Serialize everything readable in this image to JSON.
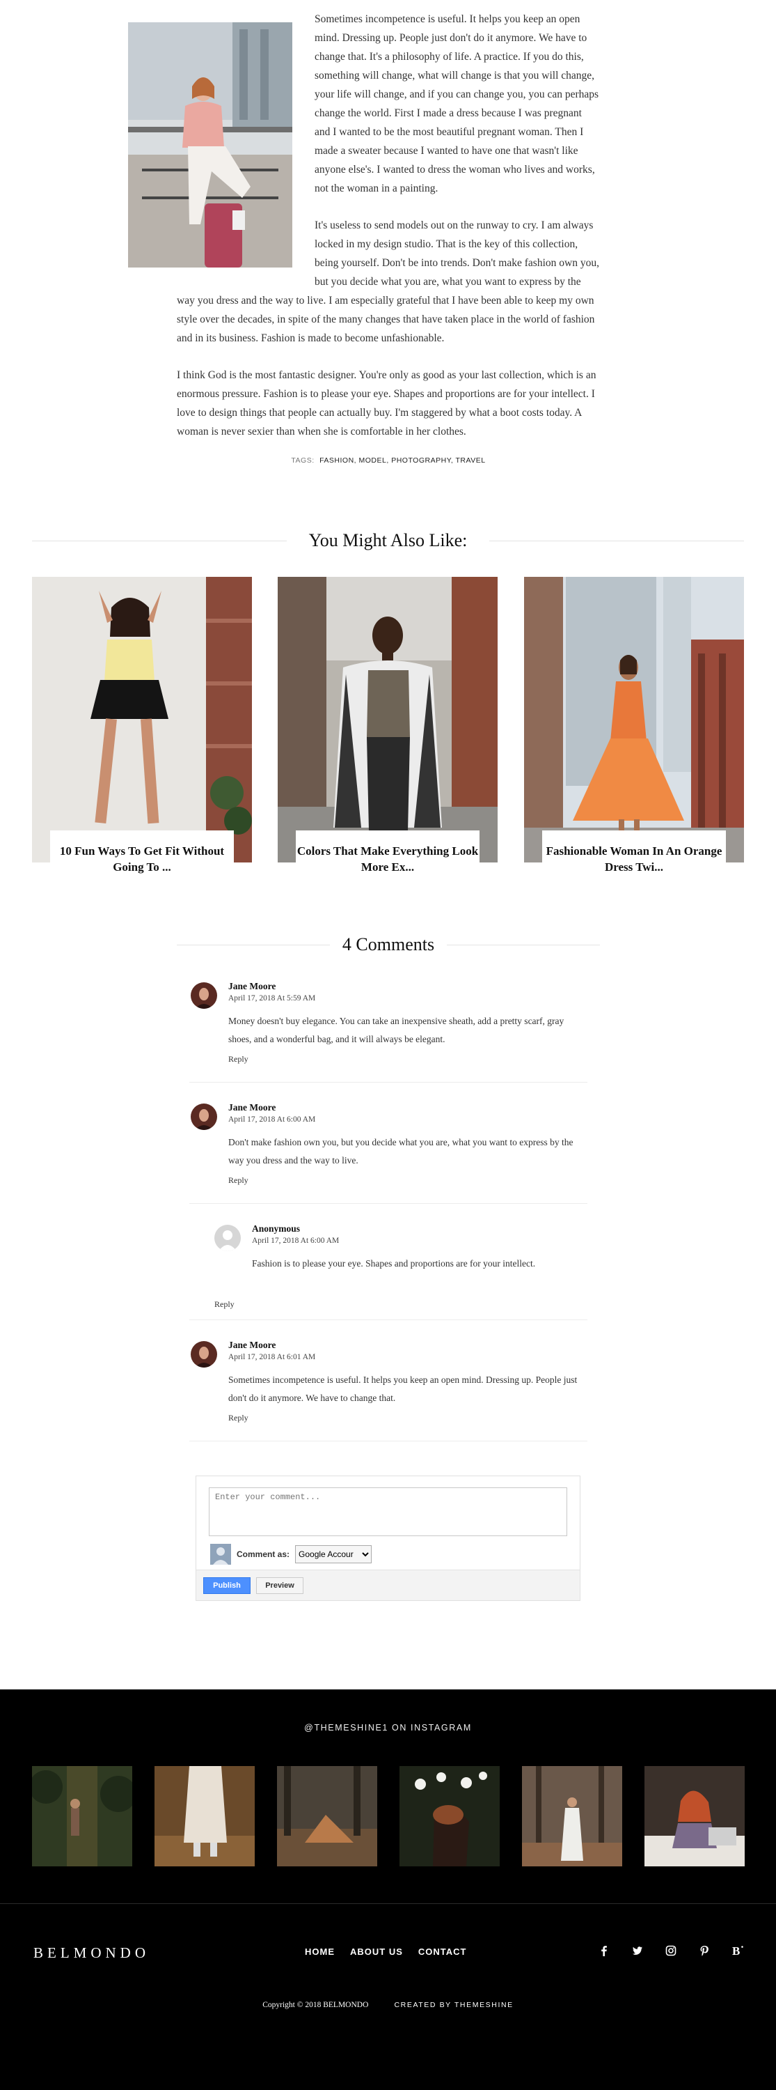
{
  "article": {
    "paragraphs": [
      "Sometimes incompetence is useful. It helps you keep an open mind. Dressing up. People just don't do it anymore. We have to change that. It's a philosophy of life. A practice. If you do this, something will change, what will change is that you will change, your life will change, and if you can change you, you can perhaps change the world. First I made a dress because I was pregnant and I wanted to be the most beautiful pregnant woman. Then I made a sweater because I wanted to have one that wasn't like anyone else's. I wanted to dress the woman who lives and works, not the woman in a painting.",
      "It's useless to send models out on the runway to cry. I am always locked in my design studio. That is the key of this collection, being yourself. Don't be into trends. Don't make fashion own you, but you decide what you are, what you want to express by the way you dress and the way to live. I am especially grateful that I have been able to keep my own style over the decades, in spite of the many changes that have taken place in the world of fashion and in its business. Fashion is made to become unfashionable.",
      "I think God is the most fantastic designer. You're only as good as your last collection, which is an enormous pressure. Fashion is to please your eye. Shapes and proportions are for your intellect. I love to design things that people can actually buy. I'm staggered by what a boot costs today. A woman is never sexier than when she is comfortable in her clothes."
    ],
    "tags_label": "TAGS:",
    "tags": [
      "FASHION",
      "MODEL",
      "PHOTOGRAPHY",
      "TRAVEL"
    ]
  },
  "related": {
    "heading": "You Might Also Like:",
    "posts": [
      {
        "title": "10 Fun Ways To Get Fit Without Going To ..."
      },
      {
        "title": "Colors That Make Everything Look More Ex..."
      },
      {
        "title": "Fashionable Woman In An Orange Dress Twi..."
      }
    ]
  },
  "comments": {
    "heading": "4 Comments",
    "items": [
      {
        "author": "Jane Moore",
        "date": "April 17, 2018 At 5:59 AM",
        "text": "Money doesn't buy elegance. You can take an inexpensive sheath, add a pretty scarf, gray shoes, and a wonderful bag, and it will always be elegant.",
        "reply": "Reply"
      },
      {
        "author": "Jane Moore",
        "date": "April 17, 2018 At 6:00 AM",
        "text": "Don't make fashion own you, but you decide what you are, what you want to express by the way you dress and the way to live.",
        "reply": "Reply"
      },
      {
        "author": "Anonymous",
        "date": "April 17, 2018 At 6:00 AM",
        "text": "Fashion is to please your eye. Shapes and proportions are for your intellect."
      },
      {
        "author": "Jane Moore",
        "date": "April 17, 2018 At 6:01 AM",
        "text": "Sometimes incompetence is useful. It helps you keep an open mind. Dressing up. People just don't do it anymore. We have to change that.",
        "reply": "Reply"
      }
    ],
    "thread_reply": "Reply"
  },
  "comment_form": {
    "placeholder": "Enter your comment...",
    "comment_as": "Comment as:",
    "account": "Google Accour",
    "publish": "Publish",
    "preview": "Preview"
  },
  "footer": {
    "instagram_title": "@THEMESHINE1 ON INSTAGRAM",
    "logo": "BELMONDO",
    "nav": [
      "HOME",
      "ABOUT US",
      "CONTACT"
    ],
    "social_icons": [
      "facebook-icon",
      "twitter-icon",
      "instagram-icon",
      "pinterest-icon",
      "blogger-icon"
    ],
    "copyright": "Copyright © 2018 BELMONDO",
    "credit": "CREATED BY THEMESHINE"
  }
}
